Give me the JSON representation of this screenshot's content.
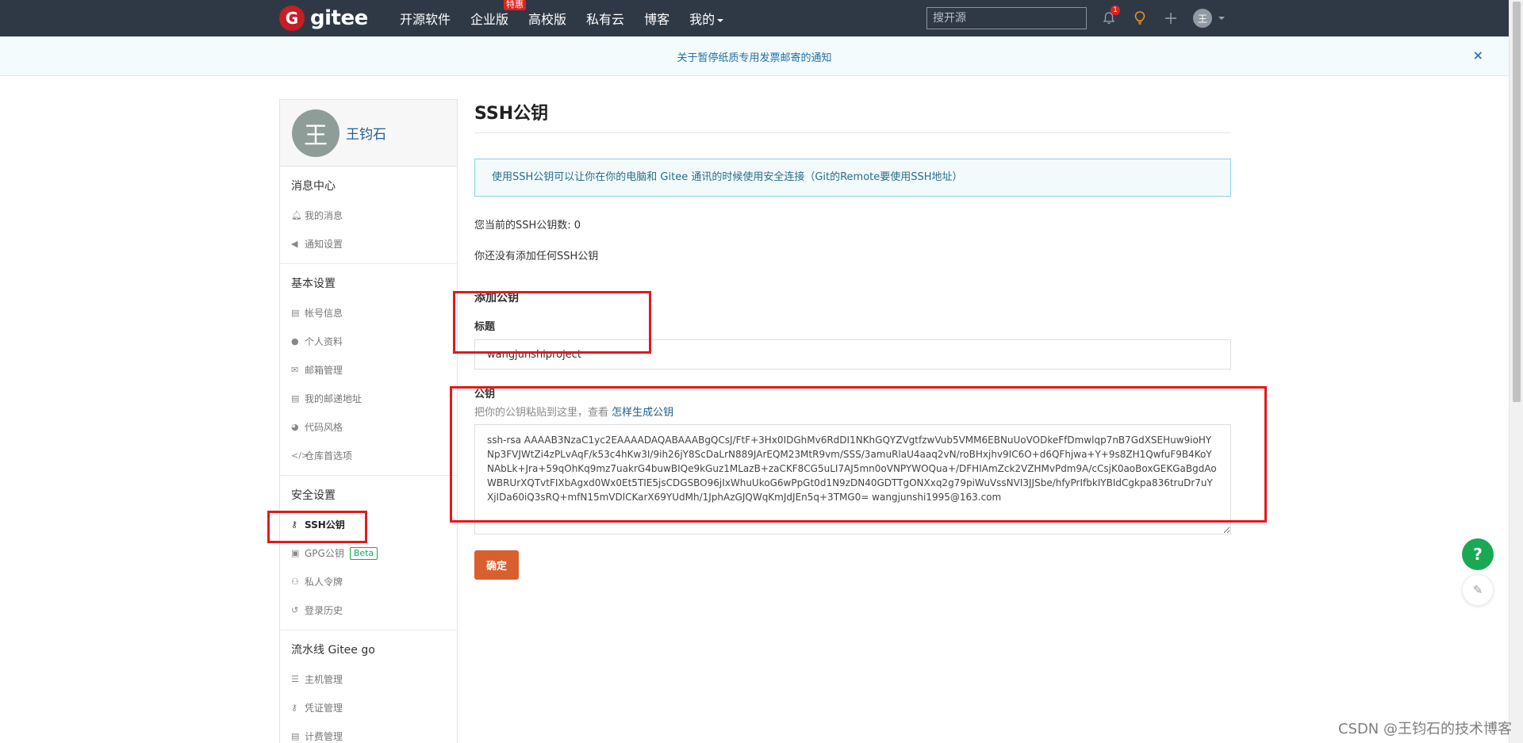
{
  "nav": {
    "logo_letter": "G",
    "logo_text": "gitee",
    "links": [
      "开源软件",
      "企业版",
      "高校版",
      "私有云",
      "博客",
      "我的"
    ],
    "hot_badge": "特惠",
    "search_placeholder": "搜开源",
    "bell_count": "1",
    "plus": "+",
    "avatar_letter": "王"
  },
  "banner": {
    "text": "关于暂停纸质专用发票邮寄的通知",
    "close": "×"
  },
  "sidebar": {
    "avatar_letter": "王",
    "username": "王钧石",
    "sections": [
      {
        "title": "消息中心",
        "items": [
          {
            "icon": "bell-icon",
            "label": "我的消息"
          },
          {
            "icon": "speaker-icon",
            "label": "通知设置"
          }
        ]
      },
      {
        "title": "基本设置",
        "items": [
          {
            "icon": "id-card-icon",
            "label": "帐号信息"
          },
          {
            "icon": "user-icon",
            "label": "个人资料"
          },
          {
            "icon": "envelope-icon",
            "label": "邮箱管理"
          },
          {
            "icon": "id-card-icon",
            "label": "我的邮递地址"
          },
          {
            "icon": "palette-icon",
            "label": "代码风格"
          },
          {
            "icon": "code-icon",
            "label": "仓库首选项"
          }
        ]
      },
      {
        "title": "安全设置",
        "items": [
          {
            "icon": "key-icon",
            "label": "SSH公钥"
          },
          {
            "icon": "lock-icon",
            "label": "GPG公钥",
            "badge": "Beta"
          },
          {
            "icon": "token-icon",
            "label": "私人令牌"
          },
          {
            "icon": "history-icon",
            "label": "登录历史"
          }
        ]
      },
      {
        "title": "流水线 Gitee go",
        "items": [
          {
            "icon": "server-icon",
            "label": "主机管理"
          },
          {
            "icon": "key-icon",
            "label": "凭证管理"
          },
          {
            "icon": "billing-icon",
            "label": "计费管理"
          }
        ]
      }
    ]
  },
  "main": {
    "title": "SSH公钥",
    "info": "使用SSH公钥可以让你在你的电脑和 Gitee 通讯的时候使用安全连接（Git的Remote要使用SSH地址）",
    "count_text": "您当前的SSH公钥数: 0",
    "empty_text": "你还没有添加任何SSH公钥",
    "add_title": "添加公钥",
    "title_label": "标题",
    "title_value": "wangjunshiproject",
    "key_label": "公钥",
    "key_hint": "把你的公钥粘贴到这里，查看",
    "key_hint_link": "怎样生成公钥",
    "key_value": "ssh-rsa AAAAB3NzaC1yc2EAAAADAQABAAABgQCsJ/FtF+3Hx0IDGhMv6RdDI1NKhGQYZVgtfzwVub5VMM6EBNuUoVODkeFfDmwlqp7nB7GdXSEHuw9ioHYNp3FVJWtZi4zPLvAqF/k53c4hKw3I/9ih26jY8ScDaLrN889JArEQM23MtR9vm/SSS/3amuRlaU4aaq2vN/roBHxjhv9IC6O+d6QFhjwa+Y+9s8ZH1QwfuF9B4KoYNAbLk+Jra+59qOhKq9mz7uakrG4buwBIQe9kGuz1MLazB+zaCKF8CG5uLI7AJ5mn0oVNPYWOQua+/DFHIAmZck2VZHMvPdm9A/cCsjK0aoBoxGEKGaBgdAoWBRUrXQTvtFIXbAgxd0Wx0Et5TIE5jsCDGSBO96jIxWhuUkoG6wPpGt0d1N9zDN40GDTTgONXxq2g79piWuVssNVI3JJSbe/hfyPrIfbkIYBIdCgkpa836truDr7uYXjIDa60iQ3sRQ+mfN15mVDlCKarX69YUdMh/1JphAzGJQWqKmJdJEn5q+3TMG0= wangjunshi1995@163.com",
    "submit": "确定"
  },
  "floats": {
    "help": "?",
    "feedback": "✎"
  },
  "watermark": "CSDN @王钧石的技术博客"
}
